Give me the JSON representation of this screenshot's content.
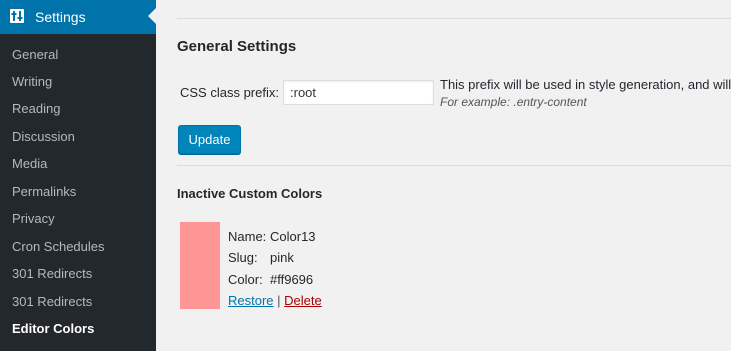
{
  "sidebar": {
    "header_label": "Settings",
    "items": [
      {
        "label": "General"
      },
      {
        "label": "Writing"
      },
      {
        "label": "Reading"
      },
      {
        "label": "Discussion"
      },
      {
        "label": "Media"
      },
      {
        "label": "Permalinks"
      },
      {
        "label": "Privacy"
      },
      {
        "label": "Cron Schedules"
      },
      {
        "label": "301 Redirects"
      },
      {
        "label": "301 Redirects"
      },
      {
        "label": "Editor Colors"
      }
    ],
    "current_index": 10
  },
  "general": {
    "title": "General Settings",
    "field_label": "CSS class prefix:",
    "field_value": ":root",
    "description": "This prefix will be used in style generation, and will",
    "example": "For example: .entry-content",
    "update_label": "Update"
  },
  "inactive": {
    "title": "Inactive Custom Colors",
    "color": {
      "name_key": "Name:",
      "name": "Color13",
      "slug_key": "Slug:",
      "slug": "pink",
      "color_key": "Color:",
      "hex": "#ff9696",
      "restore_label": "Restore",
      "separator": "|",
      "delete_label": "Delete"
    }
  },
  "colors": {
    "sidebar_bg": "#23282d",
    "accent": "#0073aa",
    "swatch": "#ff9696"
  }
}
